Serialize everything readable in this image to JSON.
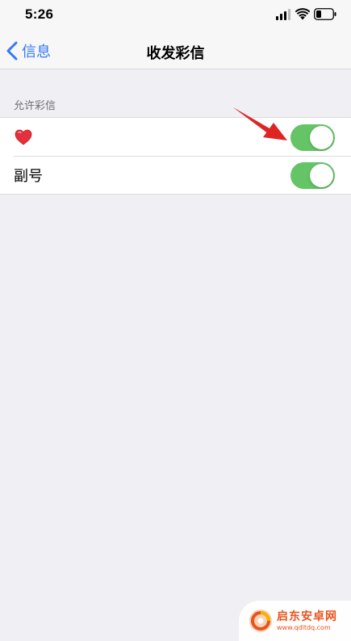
{
  "status_bar": {
    "time": "5:26"
  },
  "nav": {
    "back_label": "信息",
    "title": "收发彩信"
  },
  "section": {
    "header": "允许彩信",
    "rows": [
      {
        "label": "",
        "icon": "heart-emoji",
        "toggle_on": true
      },
      {
        "label": "副号",
        "icon": "",
        "toggle_on": true
      }
    ]
  },
  "colors": {
    "accent": "#3478f6",
    "toggle_on": "#65c466",
    "annotation": "#e02424",
    "watermark": "#e8541d"
  },
  "watermark": {
    "name": "启东安卓网",
    "url": "www.qdltdq.com"
  }
}
